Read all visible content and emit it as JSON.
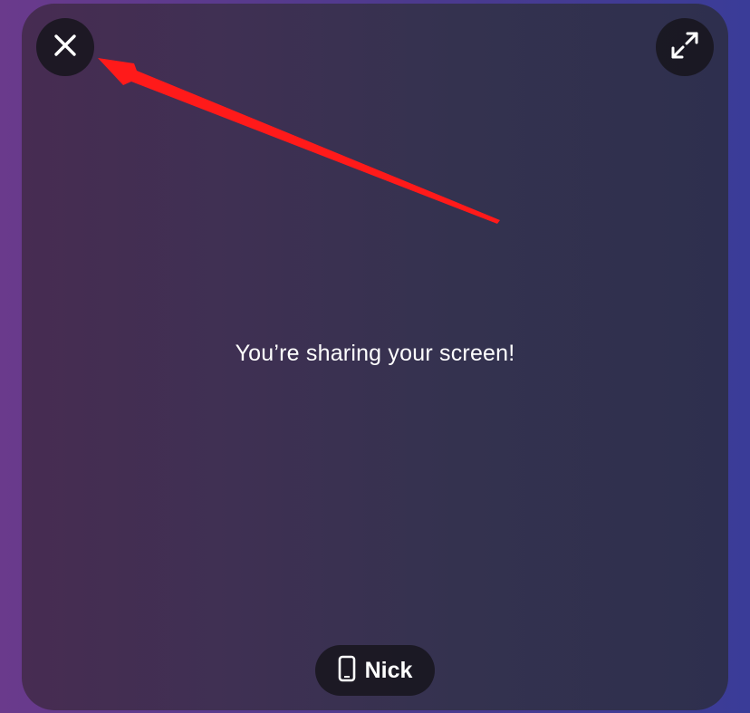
{
  "share": {
    "message": "You’re sharing your screen!"
  },
  "controls": {
    "close_icon": "close-icon",
    "expand_icon": "expand-icon"
  },
  "participant": {
    "device_icon": "phone-icon",
    "name": "Nick"
  },
  "annotation": {
    "arrow_color": "#ff1a1a"
  }
}
